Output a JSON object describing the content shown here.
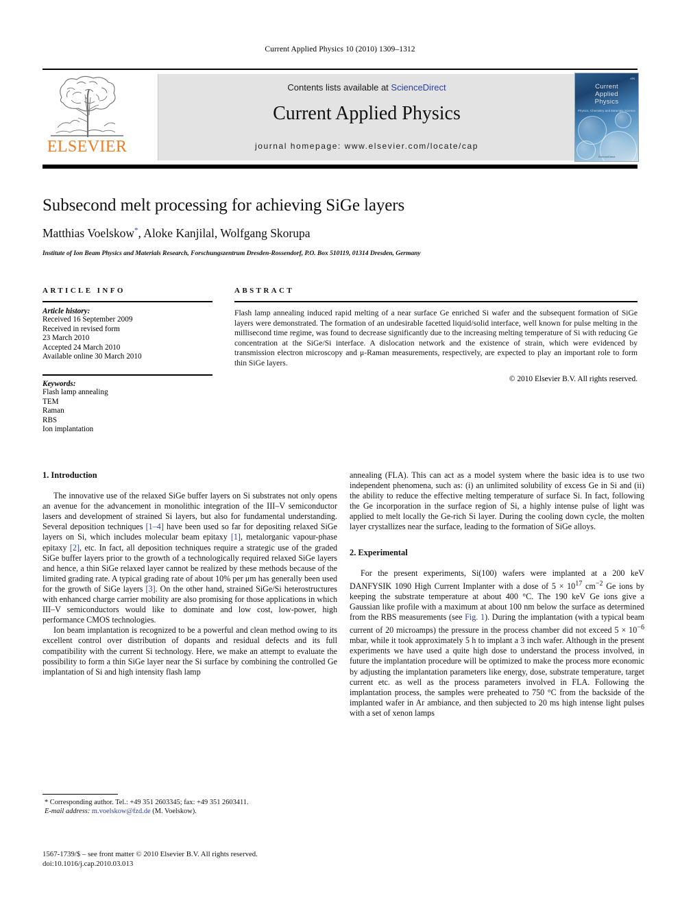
{
  "running_head": "Current Applied Physics 10 (2010) 1309–1312",
  "masthead": {
    "contents_prefix": "Contents lists available at",
    "sciencedirect": "ScienceDirect",
    "journal_name": "Current Applied Physics",
    "homepage": "journal homepage: www.elsevier.com/locate/cap",
    "publisher_word": "ELSEVIER",
    "cover": {
      "line1": "Current",
      "line2": "Applied",
      "line3": "Physics",
      "subtitle": "Physics, Chemistry and Materials Science",
      "badge": "KPS",
      "badge_sub": "한국물리학회",
      "footer": "ScienceDirect"
    },
    "link_color": "#2b3fa0",
    "brand_color": "#f07c22"
  },
  "article": {
    "title": "Subsecond melt processing for achieving SiGe layers",
    "authors": "Matthias Voelskow",
    "authors_rest": ", Aloke Kanjilal, Wolfgang Skorupa",
    "corresponding_marker": "*",
    "affiliation": "Institute of Ion Beam Physics and Materials Research, Forschungszentrum Dresden-Rossendorf, P.O. Box 510119, 01314 Dresden, Germany"
  },
  "article_info": {
    "heading": "ARTICLE INFO",
    "history_label": "Article history:",
    "history": [
      "Received 16 September 2009",
      "Received in revised form",
      "23 March 2010",
      "Accepted 24 March 2010",
      "Available online 30 March 2010"
    ],
    "keywords_label": "Keywords:",
    "keywords": [
      "Flash lamp annealing",
      "TEM",
      "Raman",
      "RBS",
      "Ion implantation"
    ]
  },
  "abstract": {
    "heading": "ABSTRACT",
    "text": "Flash lamp annealing induced rapid melting of a near surface Ge enriched Si wafer and the subsequent formation of SiGe layers were demonstrated. The formation of an undesirable facetted liquid/solid interface, well known for pulse melting in the millisecond time regime, was found to decrease significantly due to the increasing melting temperature of Si with reducing Ge concentration at the SiGe/Si interface. A dislocation network and the existence of strain, which were evidenced by transmission electron microscopy and μ-Raman measurements, respectively, are expected to play an important role to form thin SiGe layers.",
    "copyright": "© 2010 Elsevier B.V. All rights reserved."
  },
  "body": {
    "section1_heading": "1. Introduction",
    "intro_p1_a": "The innovative use of the relaxed SiGe buffer layers on Si substrates not only opens an avenue for the advancement in monolithic integration of the III–V semiconductor lasers and development of strained Si layers, but also for fundamental understanding. Several deposition techniques ",
    "ref_1_4": "[1–4]",
    "intro_p1_b": " have been used so far for depositing relaxed SiGe layers on Si, which includes molecular beam epitaxy ",
    "ref_1": "[1]",
    "intro_p1_c": ", metalorganic vapour-phase epitaxy ",
    "ref_2": "[2]",
    "intro_p1_d": ", etc. In fact, all deposition techniques require a strategic use of the graded SiGe buffer layers prior to the growth of a technologically required relaxed SiGe layers and hence, a thin SiGe relaxed layer cannot be realized by these methods because of the limited grading rate. A typical grading rate of about 10% per μm has generally been used for the growth of SiGe layers ",
    "ref_3": "[3]",
    "intro_p1_e": ". On the other hand, strained SiGe/Si heterostructures with enhanced charge carrier mobility are also promising for those applications in which III–V semiconductors would like to dominate and low cost, low-power, high performance CMOS technologies.",
    "intro_p2": "Ion beam implantation is recognized to be a powerful and clean method owing to its excellent control over distribution of dopants and residual defects and its full compatibility with the current Si technology. Here, we make an attempt to evaluate the possibility to form a thin SiGe layer near the Si surface by combining the controlled Ge implantation of Si and high intensity flash lamp",
    "intro_p2_cont": "annealing (FLA). This can act as a model system where the basic idea is to use two independent phenomena, such as: (i) an unlimited solubility of excess Ge in Si and (ii) the ability to reduce the effective melting temperature of surface Si. In fact, following the Ge incorporation in the surface region of Si, a highly intense pulse of light was applied to melt locally the Ge-rich Si layer. During the cooling down cycle, the molten layer crystallizes near the surface, leading to the formation of SiGe alloys.",
    "section2_heading": "2. Experimental",
    "exp_p1_a": "For the present experiments, Si(100) wafers were implanted at a 200 keV DANFYSIK 1090 High Current Implanter with a dose of 5 × 10",
    "exp_sup_17": "17",
    "exp_p1_b": " cm",
    "exp_sup_m2": "−2",
    "exp_p1_c": " Ge ions by keeping the substrate temperature at about 400 °C. The 190 keV Ge ions give a Gaussian like profile with a maximum at about 100 nm below the surface as determined from the RBS measurements (see ",
    "ref_fig1": "Fig. 1",
    "exp_p1_d": "). During the implantation (with a typical beam current of 20 microamps) the pressure in the process chamber did not exceed 5 × 10",
    "exp_sup_m6": "−6",
    "exp_p1_e": " mbar, while it took approximately 5 h to implant a 3 inch wafer. Although in the present experiments we have used a quite high dose to understand the process involved, in future the implantation procedure will be optimized to make the process more economic by adjusting the implantation parameters like energy, dose, substrate temperature, target current etc. as well as the process parameters involved in FLA. Following the implantation process, the samples were preheated to 750 °C from the backside of the implanted wafer in Ar ambiance, and then subjected to 20 ms high intense light pulses with a set of xenon lamps"
  },
  "footnote": {
    "corresponding": "* Corresponding author. Tel.: +49 351 2603345; fax: +49 351 2603411.",
    "email_label": "E-mail address:",
    "email": "m.voelskow@fzd.de",
    "email_owner": "(M. Voelskow).",
    "imprint_line1": "1567-1739/$ – see front matter © 2010 Elsevier B.V. All rights reserved.",
    "imprint_line2": "doi:10.1016/j.cap.2010.03.013"
  }
}
